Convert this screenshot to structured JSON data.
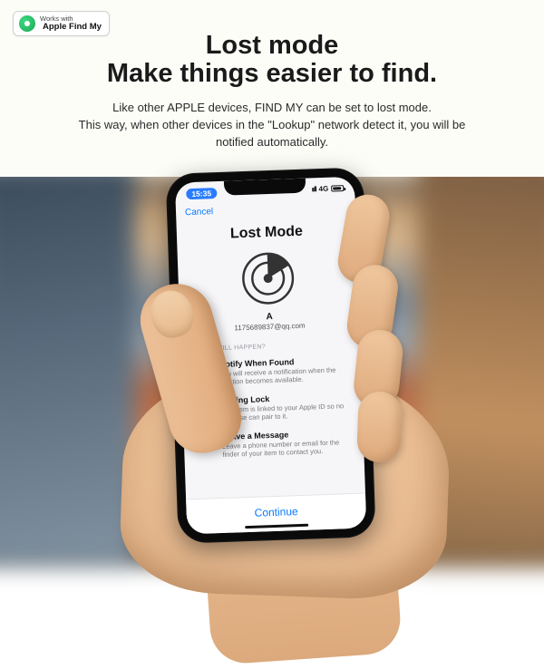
{
  "badge": {
    "line1": "Works with",
    "line2": "Apple Find My"
  },
  "headline": {
    "t1": "Lost mode",
    "t2": "Make things easier to find."
  },
  "subtext": {
    "l1": "Like other APPLE devices, FIND MY can be set to lost mode.",
    "l2": "This way, when other devices in the \"Lookup\" network detect it, you will be",
    "l3": "notified automatically."
  },
  "statusbar": {
    "time": "15:35",
    "carrier_hint": "4G"
  },
  "navbar": {
    "cancel": "Cancel"
  },
  "lostmode": {
    "title": "Lost Mode",
    "item_name": "A",
    "item_email": "1175689837@qq.com",
    "section_label": "WHAT WILL HAPPEN?",
    "rows": [
      {
        "title": "Notify When Found",
        "sub": "You will receive a notification when the location becomes available."
      },
      {
        "title": "Pairing Lock",
        "sub": "This item is linked to your Apple ID so no one else can pair to it."
      },
      {
        "title": "Leave a Message",
        "sub": "Leave a phone number or email for the finder of your item to contact you."
      }
    ],
    "continue": "Continue"
  }
}
